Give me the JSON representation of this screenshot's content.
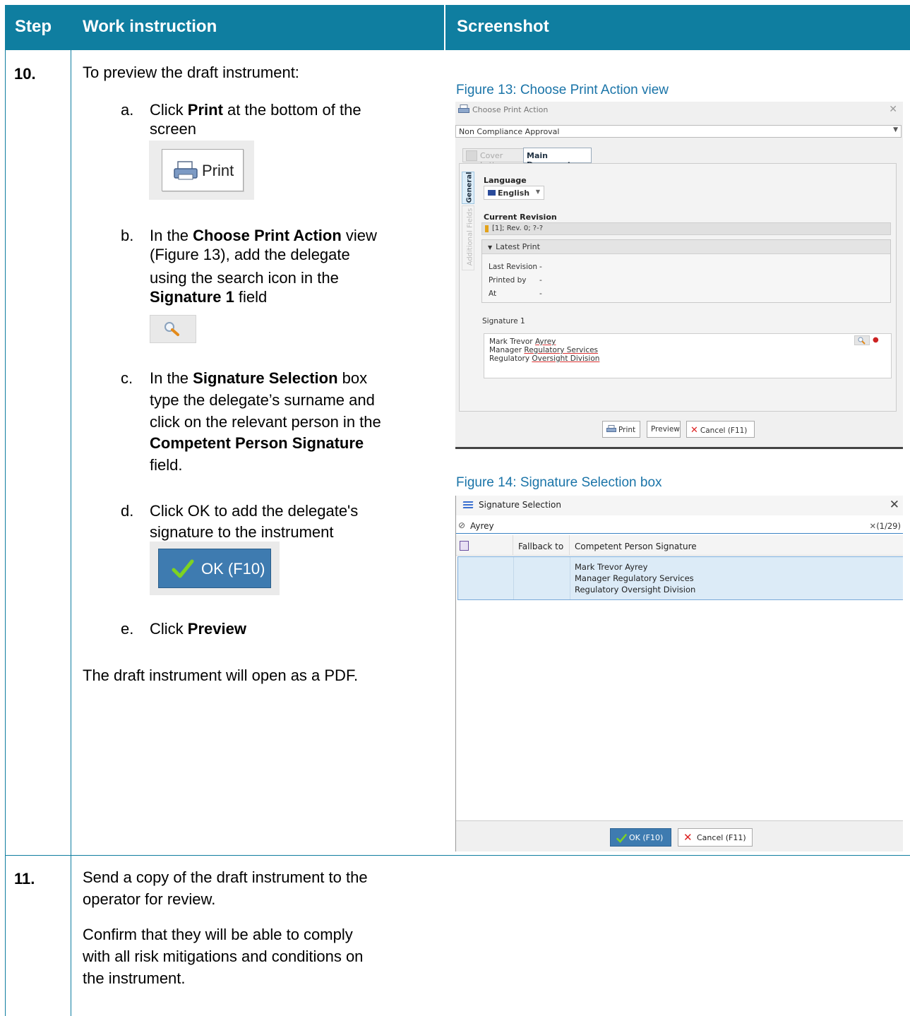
{
  "table_header": {
    "step": "Step",
    "work_instruction": "Work instruction",
    "screenshot": "Screenshot"
  },
  "step10": {
    "number": "10.",
    "intro": "To preview the draft instrument:",
    "a": {
      "letter": "a.",
      "pre": "Click ",
      "bold": "Print",
      "post": " at the bottom of the",
      "line2": "screen"
    },
    "print_image_label": "Print",
    "b": {
      "letter": "b.",
      "l1_pre": "In the ",
      "l1_bold": "Choose Print Action",
      "l1_post": " view",
      "l2": "(Figure 13), add the delegate",
      "l3": "using the search icon in the",
      "l4_bold": "Signature 1",
      "l4_post": " field"
    },
    "c": {
      "letter": "c.",
      "l1_pre": "In the ",
      "l1_bold": "Signature Selection",
      "l1_post": " box",
      "l2": "type the delegate’s surname and",
      "l3": "click on the relevant person in the",
      "l4_bold": "Competent Person Signature",
      "l5": "field."
    },
    "d": {
      "letter": "d.",
      "l1": "Click OK to add the delegate's",
      "l2": "signature to the instrument"
    },
    "ok_image_label": "OK (F10)",
    "e": {
      "letter": "e.",
      "pre": "Click ",
      "bold": "Preview"
    },
    "outro": "The draft instrument will open as a PDF."
  },
  "step11": {
    "number": "11.",
    "p1_l1": "Send a copy of the draft instrument to the",
    "p1_l2": "operator for review.",
    "p2_l1": "Confirm that they will be able to comply",
    "p2_l2": "with all risk mitigations and conditions on",
    "p2_l3": "the instrument."
  },
  "figure13": {
    "caption": "Figure 13: Choose Print Action view",
    "window_title": "Choose Print Action",
    "dropdown_value": "Non Compliance Approval",
    "tab_cover_letter": "Cover Letter",
    "tab_main_document": "Main Document",
    "vtab_general": "General",
    "vtab_additional": "Additional Fields",
    "language_label": "Language",
    "language_value": "English",
    "current_revision_label": "Current Revision",
    "current_revision_value": "[1]; Rev. 0; ?-?",
    "latest_print_header": "Latest Print",
    "last_revision_label": "Last Revision",
    "last_revision_value": "-",
    "printed_by_label": "Printed by",
    "printed_by_value": "-",
    "at_label": "At",
    "at_value": "-",
    "signature1_label": "Signature 1",
    "sig_name_pre": "Mark Trevor ",
    "sig_name_u": "Ayrey",
    "sig_title_pre": "Manager ",
    "sig_title_u": "Regulatory Services",
    "sig_division_pre": "Regulatory ",
    "sig_division_u": "Oversight Division",
    "btn_print": "Print",
    "btn_preview": "Preview",
    "btn_cancel": "Cancel (F11)"
  },
  "figure14": {
    "caption": "Figure 14: Signature Selection box",
    "window_title": "Signature Selection",
    "search_value": "Ayrey",
    "search_count": "(1/29)",
    "col_fallback": "Fallback to",
    "col_signature": "Competent Person Signature",
    "row_line1": "Mark Trevor Ayrey",
    "row_line2": "Manager Regulatory Services",
    "row_line3": "Regulatory Oversight Division",
    "btn_ok": "OK (F10)",
    "btn_cancel": "Cancel (F11)"
  }
}
